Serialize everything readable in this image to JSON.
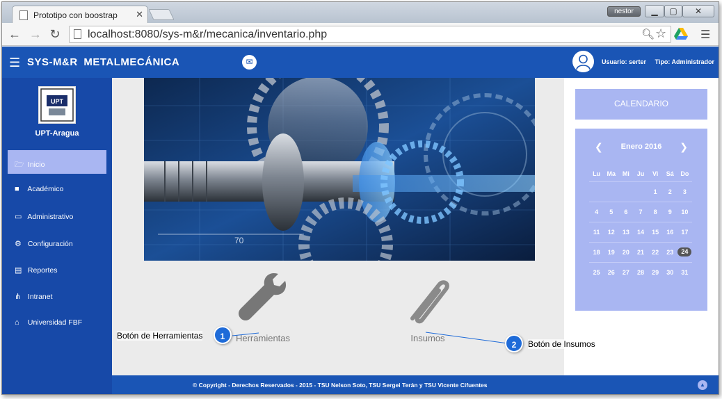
{
  "browser": {
    "tab_title": "Prototipo con boostrap",
    "tab_close": "✕",
    "user_badge": "nestor",
    "url": "localhost:8080/sys-m&r/mecanica/inventario.php",
    "icons": [
      "back-icon",
      "forward-icon",
      "reload-icon",
      "zoom-icon",
      "star-icon",
      "drive-icon",
      "menu-icon"
    ]
  },
  "header": {
    "brand": "SYS-M&R  METALMECÁNICA",
    "user_label": "Usuario: serter",
    "role_label": "Tipo: Administrador"
  },
  "sidebar": {
    "org": "UPT-Aragua",
    "logo_text": "UPT",
    "items": [
      {
        "label": "Inicio",
        "icon": "folder-icon",
        "glyph": "🗁",
        "active": true
      },
      {
        "label": "Académico",
        "icon": "book-icon",
        "glyph": "■",
        "active": false
      },
      {
        "label": "Administrativo",
        "icon": "monitor-icon",
        "glyph": "▭",
        "active": false
      },
      {
        "label": "Configuración",
        "icon": "gears-icon",
        "glyph": "⚙",
        "active": false
      },
      {
        "label": "Reportes",
        "icon": "document-icon",
        "glyph": "▤",
        "active": false
      },
      {
        "label": "Intranet",
        "icon": "sitemap-icon",
        "glyph": "⋔",
        "active": false
      },
      {
        "label": "Universidad FBF",
        "icon": "university-icon",
        "glyph": "⌂",
        "active": false
      }
    ]
  },
  "quick_actions": {
    "tools_label": "Herramientas",
    "supplies_label": "Insumos"
  },
  "calendar": {
    "title": "CALENDARIO",
    "month": "Enero 2016",
    "weekdays": [
      "Lu",
      "Ma",
      "Mi",
      "Ju",
      "Vi",
      "Sá",
      "Do"
    ],
    "weeks": [
      [
        "",
        "",
        "",
        "",
        "1",
        "2",
        "3"
      ],
      [
        "4",
        "5",
        "6",
        "7",
        "8",
        "9",
        "10"
      ],
      [
        "11",
        "12",
        "13",
        "14",
        "15",
        "16",
        "17"
      ],
      [
        "18",
        "19",
        "20",
        "21",
        "22",
        "23",
        "24"
      ],
      [
        "25",
        "26",
        "27",
        "28",
        "29",
        "30",
        "31"
      ]
    ],
    "today": "24"
  },
  "footer": {
    "text": "© Copyright - Derechos Reservados - 2015 - TSU Nelson Soto, TSU Sergei Terán y TSU Vicente Cifuentes"
  },
  "callouts": [
    {
      "number": "1",
      "label": "Botón de Herramientas"
    },
    {
      "number": "2",
      "label": "Botón de Insumos"
    }
  ],
  "colors": {
    "primary": "#1a55b5",
    "sidebar": "#1749a8",
    "accent": "#a9b6f2",
    "callout": "#1f6bd8"
  }
}
